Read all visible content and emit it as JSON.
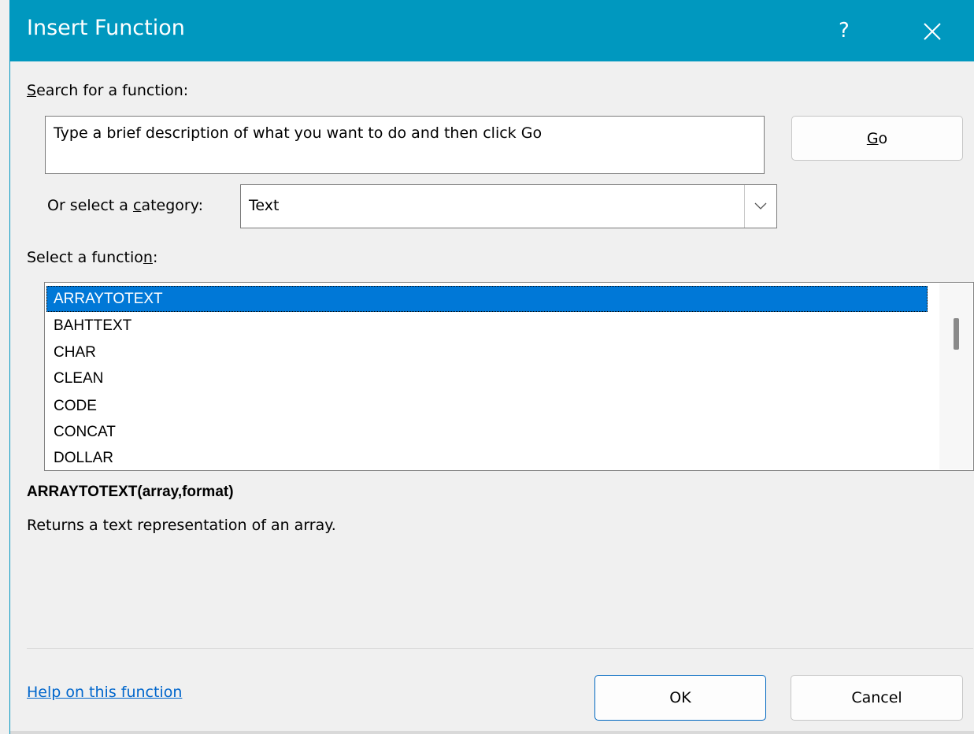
{
  "dialog": {
    "title": "Insert Function",
    "help_glyph": "?",
    "close_glyph": "✕"
  },
  "search": {
    "label_first": "S",
    "label_rest": "earch for a function:",
    "placeholder": "Type a brief description of what you want to do and then click Go",
    "go_first": "G",
    "go_rest": "o"
  },
  "category": {
    "label_before": "Or select a ",
    "label_accel": "c",
    "label_after": "ategory:",
    "selected": "Text"
  },
  "function_list": {
    "label_before": "Select a functio",
    "label_accel": "n",
    "label_after": ":",
    "items": [
      "ARRAYTOTEXT",
      "BAHTTEXT",
      "CHAR",
      "CLEAN",
      "CODE",
      "CONCAT",
      "DOLLAR"
    ],
    "selected_index": 0
  },
  "details": {
    "signature": "ARRAYTOTEXT(array,format)",
    "description": "Returns a text representation of an array."
  },
  "footer": {
    "help_link": "Help on this function",
    "ok_label": "OK",
    "cancel_label": "Cancel"
  },
  "colors": {
    "titlebar": "#0098bf",
    "selection": "#0078d7",
    "link": "#0066cc"
  }
}
